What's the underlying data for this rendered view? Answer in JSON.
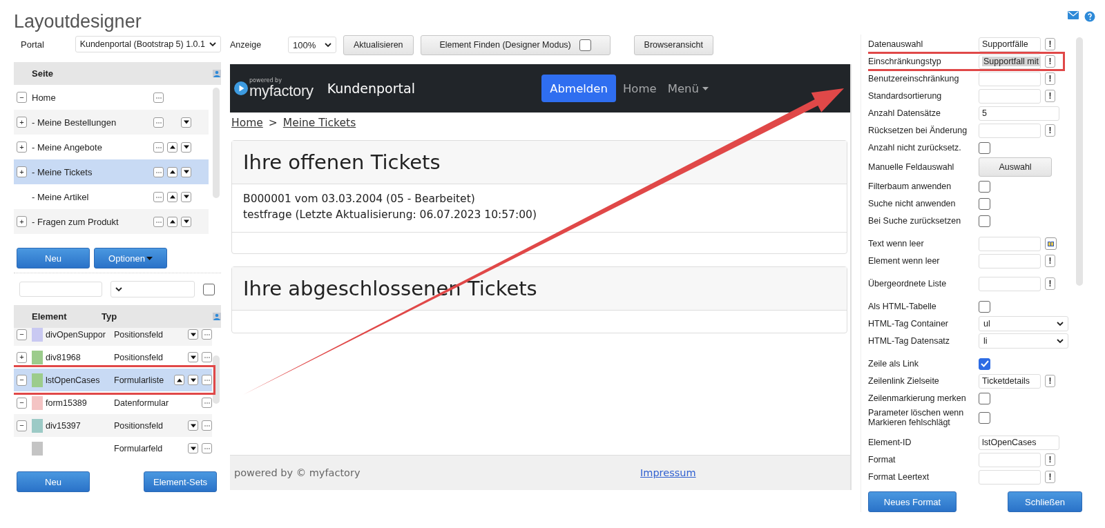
{
  "header": {
    "title": "Layoutdesigner"
  },
  "left": {
    "portal": {
      "label": "Portal",
      "value": "Kundenportal (Bootstrap 5) 1.0.1"
    },
    "pages": {
      "column": "Seite",
      "rows": [
        {
          "toggle": "−",
          "label": "Home",
          "up": false,
          "down": false,
          "selected": false
        },
        {
          "toggle": "+",
          "label": "- Meine Bestellungen",
          "up": false,
          "down": true,
          "selected": false
        },
        {
          "toggle": "+",
          "label": "- Meine Angebote",
          "up": true,
          "down": true,
          "selected": false
        },
        {
          "toggle": "+",
          "label": "- Meine Tickets",
          "up": true,
          "down": true,
          "selected": true
        },
        {
          "label": "- Meine Artikel",
          "up": true,
          "down": true,
          "selected": false
        },
        {
          "toggle": "+",
          "label": "- Fragen zum Produkt",
          "up": true,
          "down": true,
          "selected": false
        }
      ]
    },
    "page_buttons": [
      "Neu",
      "Optionen"
    ],
    "filter": {
      "checked": false
    },
    "elements": {
      "columns": [
        "Element",
        "Typ"
      ],
      "rows": [
        {
          "toggle": "−",
          "color": "#c9c9f2",
          "name": "divOpenSuppor",
          "type": "Positionsfeld",
          "up": false,
          "down": true,
          "selected": false,
          "highlighted": false
        },
        {
          "toggle": "+",
          "color": "#9ccc8c",
          "name": "div81968",
          "type": "Positionsfeld",
          "up": false,
          "down": true,
          "selected": false,
          "highlighted": false
        },
        {
          "toggle": "−",
          "color": "#9ccc8c",
          "name": "lstOpenCases",
          "type": "Formularliste",
          "up": true,
          "down": true,
          "selected": true,
          "highlighted": true
        },
        {
          "toggle": "−",
          "color": "#f4c4c4",
          "name": "form15389",
          "type": "Datenformular",
          "up": false,
          "down": false,
          "selected": false,
          "highlighted": false
        },
        {
          "toggle": "−",
          "color": "#9ccac6",
          "name": "div15397",
          "type": "Positionsfeld",
          "up": false,
          "down": true,
          "selected": false,
          "highlighted": false
        },
        {
          "color": "#c4c4c4",
          "type": "Formularfeld",
          "up": false,
          "down": true,
          "selected": false,
          "highlighted": false
        }
      ]
    },
    "element_buttons": [
      "Neu",
      "Element-Sets"
    ]
  },
  "toolbar": {
    "zoom_label": "Anzeige",
    "zoom": "100%",
    "refresh": "Aktualisieren",
    "find": {
      "label": "Element Finden (Designer Modus)",
      "checked": false
    },
    "browser_view": "Browseransicht"
  },
  "preview": {
    "brand_tagline": "powered by",
    "brand": "myfactory",
    "title": "Kundenportal",
    "logout": "Abmelden",
    "nav": [
      {
        "label": "Home",
        "dropdown": false
      },
      {
        "label": "Menü",
        "dropdown": true
      }
    ],
    "breadcrumb": [
      "Home",
      "Meine Tickets"
    ],
    "separator": ">",
    "cards": [
      {
        "title": "Ihre offenen Tickets",
        "lines": [
          "B000001 vom 03.03.2004 (05 - Bearbeitet)",
          "testfrage (Letzte Aktualisierung: 06.07.2023 10:57:00)"
        ]
      },
      {
        "title": "Ihre abgeschlossenen Tickets"
      }
    ],
    "footer": {
      "text": "powered by © myfactory",
      "link": "Impressum"
    }
  },
  "properties": {
    "groups": [
      [
        {
          "kind": "field",
          "label": "Datenauswahl",
          "value": "Supportfälle",
          "action": "!",
          "highlighted": false,
          "selected": false
        },
        {
          "kind": "field",
          "label": "Einschränkungstyp",
          "value": "Supportfall mit",
          "action": "!",
          "highlighted": true,
          "selected": true
        },
        {
          "kind": "field",
          "label": "Benutzereinschränkung",
          "action": "!",
          "highlighted": false
        },
        {
          "kind": "field",
          "label": "Standardsortierung",
          "action": "!",
          "highlighted": false
        },
        {
          "kind": "field",
          "label": "Anzahl Datensätze",
          "value": "5",
          "highlighted": false,
          "selected": false
        },
        {
          "kind": "field",
          "label": "Rücksetzen bei Änderung",
          "action": "!",
          "highlighted": false
        },
        {
          "kind": "check",
          "label": "Anzahl nicht zurücksetz.",
          "checked": false
        },
        {
          "kind": "button",
          "label": "Manuelle Feldauswahl",
          "button": "Auswahl"
        },
        {
          "kind": "check",
          "label": "Filterbaum anwenden",
          "checked": false
        },
        {
          "kind": "check",
          "label": "Suche nicht anwenden",
          "checked": false
        },
        {
          "kind": "check",
          "label": "Bei Suche zurücksetzen",
          "checked": false
        }
      ],
      [
        {
          "kind": "lookup",
          "label": "Text wenn leer"
        },
        {
          "kind": "field",
          "label": "Element wenn leer",
          "action": "!",
          "highlighted": false
        }
      ],
      [
        {
          "kind": "field",
          "label": "Übergeordnete Liste",
          "action": "!",
          "highlighted": false
        }
      ],
      [
        {
          "kind": "check",
          "label": "Als HTML-Tabelle",
          "checked": false
        },
        {
          "kind": "select",
          "label": "HTML-Tag Container",
          "value": "ul"
        },
        {
          "kind": "select",
          "label": "HTML-Tag Datensatz",
          "value": "li"
        }
      ],
      [
        {
          "kind": "check",
          "label": "Zeile als Link",
          "checked": true
        },
        {
          "kind": "field",
          "label": "Zeilenlink Zielseite",
          "value": "Ticketdetails",
          "action": "!",
          "highlighted": false,
          "selected": false
        },
        {
          "kind": "check",
          "label": "Zeilenmarkierung merken",
          "checked": false
        },
        {
          "kind": "check",
          "label": "Parameter löschen wenn Markieren fehlschlägt",
          "checked": false
        }
      ],
      [
        {
          "kind": "field",
          "label": "Element-ID",
          "value": "lstOpenCases",
          "highlighted": false,
          "selected": false
        },
        {
          "kind": "field",
          "label": "Format",
          "action": "!",
          "highlighted": false
        },
        {
          "kind": "field",
          "label": "Format Leertext",
          "action": "!",
          "highlighted": false
        }
      ]
    ]
  },
  "buttons": [
    "Neues Format",
    "Schließen"
  ]
}
